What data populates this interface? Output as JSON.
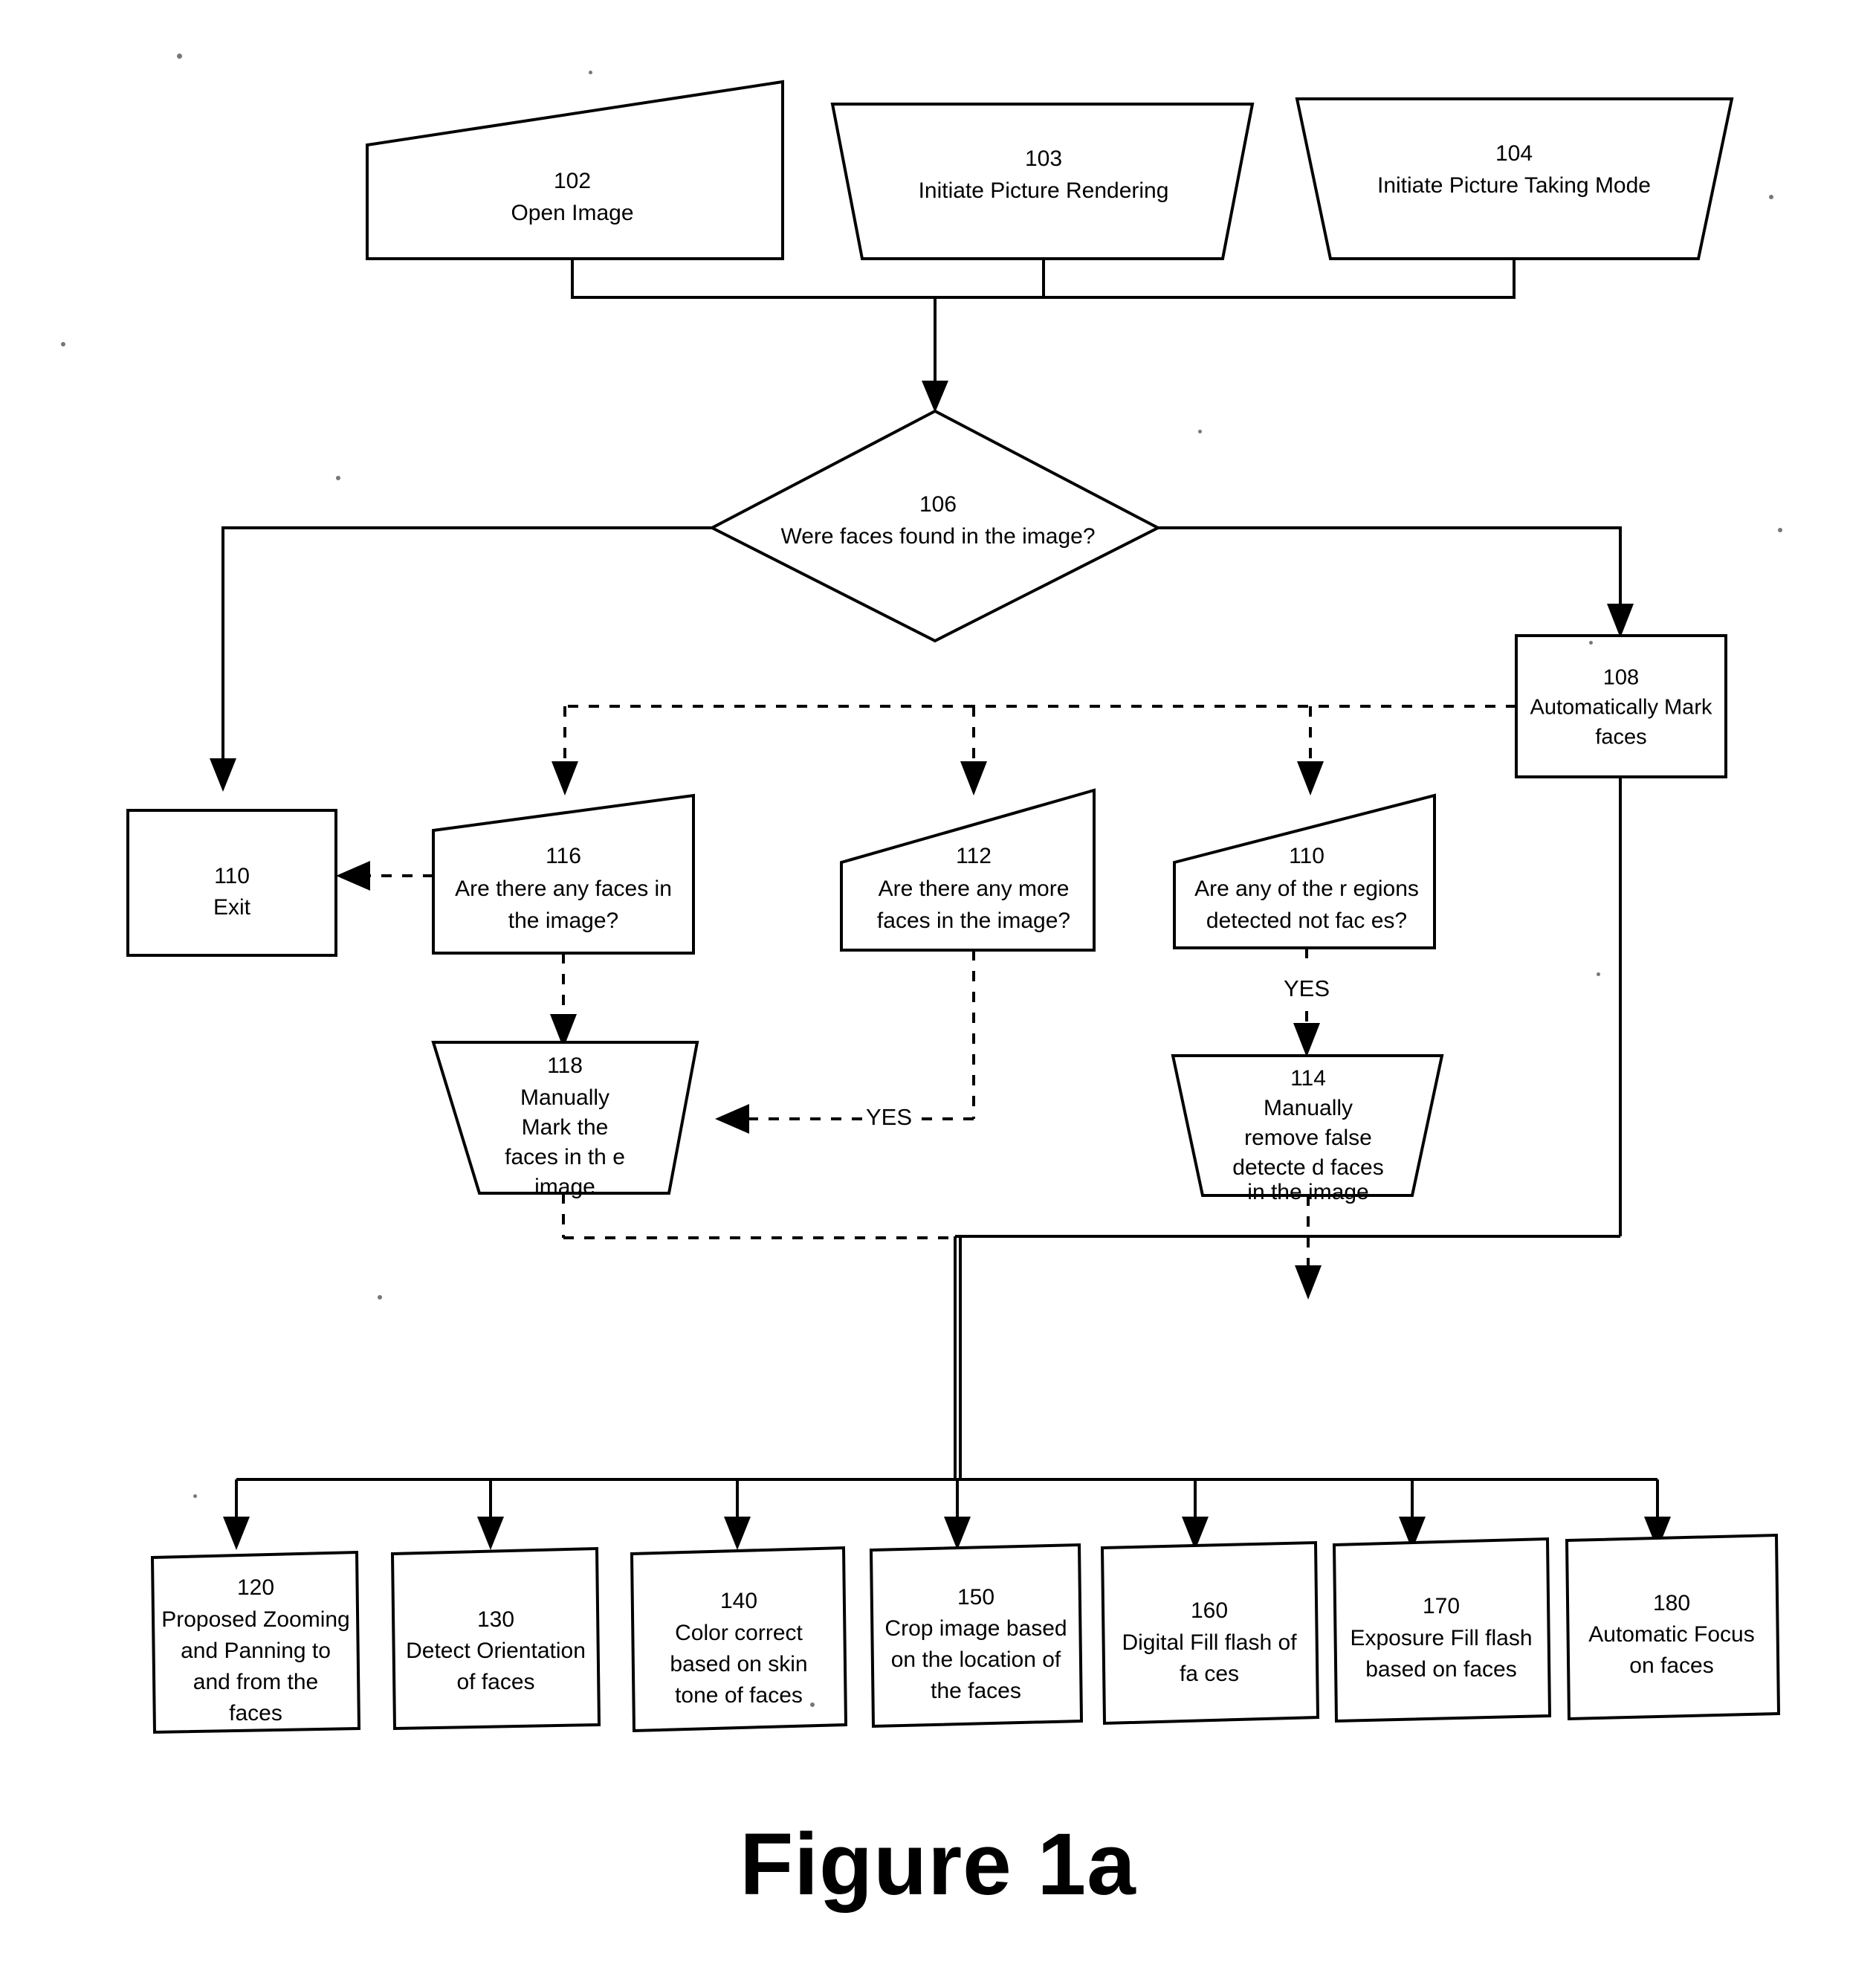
{
  "figure": {
    "caption": "Figure 1a",
    "type": "patent-flowchart"
  },
  "edge_labels": {
    "yes_112_to_118": "YES",
    "yes_110_to_114": "YES"
  },
  "nodes": {
    "n102": {
      "id": "102",
      "line1": "Open Image"
    },
    "n103": {
      "id": "103",
      "line1": "Initiate Picture Rendering"
    },
    "n104": {
      "id": "104",
      "line1": "Initiate Picture Taking Mode"
    },
    "n106": {
      "id": "106",
      "line1": "Were faces found in the image?"
    },
    "n108": {
      "id": "108",
      "line1": "Automatically Mark",
      "line2": "faces"
    },
    "n110exit": {
      "id": "110",
      "line1": "Exit"
    },
    "n116": {
      "id": "116",
      "line1": "Are there any  faces in",
      "line2": "the image?"
    },
    "n112": {
      "id": "112",
      "line1": "Are there any more",
      "line2": "faces in the image?"
    },
    "n110regions": {
      "id": "110",
      "line1": "Are any of the r egions",
      "line2": "detected not fac es?"
    },
    "n118": {
      "id": "118",
      "line1": "Manually",
      "line2": "Mark the",
      "line3": "faces in th e",
      "line4": "image"
    },
    "n114": {
      "id": "114",
      "line1": "Manually",
      "line2": "remove false",
      "line3": "detecte d faces",
      "line4": "in the image"
    },
    "n120": {
      "id": "120",
      "line1": "Proposed Zooming",
      "line2": "and Panning to",
      "line3": "and from the",
      "line4": "faces"
    },
    "n130": {
      "id": "130",
      "line1": "Detect Orientation",
      "line2": "of faces"
    },
    "n140": {
      "id": "140",
      "line1": "Color correct",
      "line2": "based on skin",
      "line3": "tone of faces"
    },
    "n150": {
      "id": "150",
      "line1": "Crop image based",
      "line2": "on the location of",
      "line3": "the faces"
    },
    "n160": {
      "id": "160",
      "line1": "Digital Fill flash of",
      "line2": "fa ces"
    },
    "n170": {
      "id": "170",
      "line1": "Exposure Fill flash",
      "line2": "based on  faces"
    },
    "n180": {
      "id": "180",
      "line1": "Automatic Focus",
      "line2": "on faces"
    }
  },
  "colors": {
    "ink": "#000000",
    "paper": "#ffffff"
  }
}
